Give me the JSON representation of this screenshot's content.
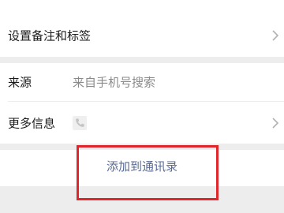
{
  "rows": {
    "remark": {
      "label": "设置备注和标签"
    },
    "source": {
      "label": "来源",
      "value": "来自手机号搜索"
    },
    "more_info": {
      "label": "更多信息"
    }
  },
  "action": {
    "add_contacts_label": "添加到通讯录"
  },
  "icons": {
    "chevron": "chevron-right-icon",
    "phone": "phone-icon"
  },
  "colors": {
    "background": "#ededed",
    "link": "#576b95",
    "highlight": "#e0252b"
  }
}
